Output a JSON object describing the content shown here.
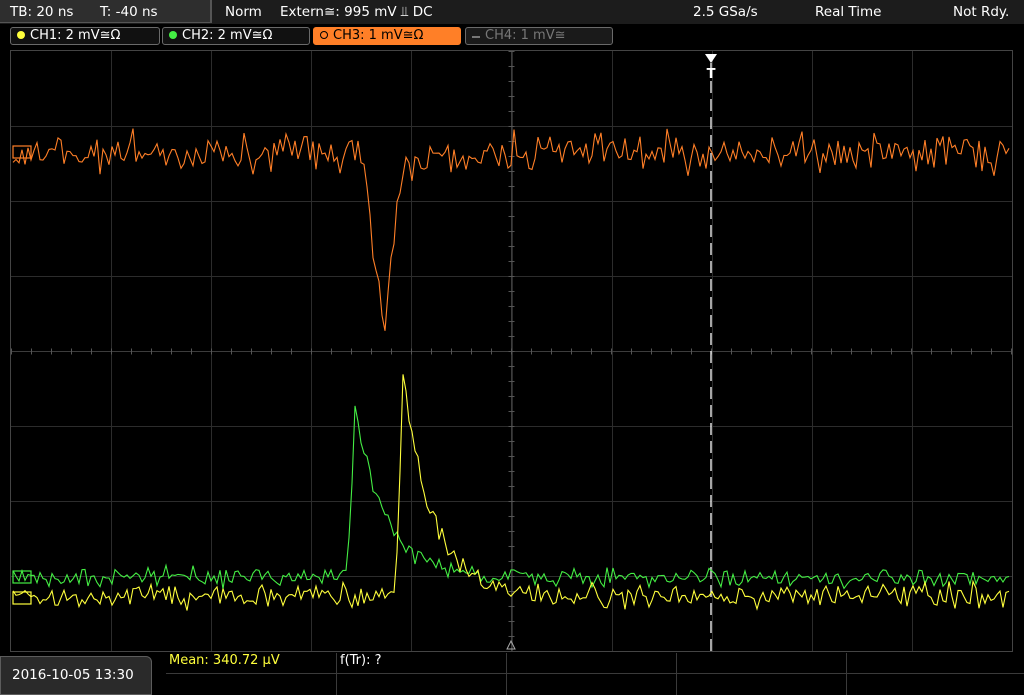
{
  "topbar": {
    "timebase": "TB: 20 ns",
    "trigger_pos": "T: -40 ns",
    "trigger_mode": "Norm",
    "trigger_source": "Extern≅: 995 mV ⫫ DC",
    "sample_rate": "2.5 GSa/s",
    "acq_mode": "Real Time",
    "status": "Not Rdy."
  },
  "channels": [
    {
      "label": "CH1: 2 mV≅Ω",
      "color": "#ffff3c",
      "active": true
    },
    {
      "label": "CH2: 2 mV≅Ω",
      "color": "#44ee44",
      "active": true
    },
    {
      "label": "CH3: 1 mV≅Ω",
      "color": "#ff7f27",
      "active": true,
      "selected": true
    },
    {
      "label": "CH4: 1 mV≅",
      "color": "#666666",
      "active": false
    }
  ],
  "waveform_colors": {
    "ch1": "#ffff3c",
    "ch2": "#44ee44",
    "ch3": "#ff7f27"
  },
  "trigger_marker": "T",
  "footer": {
    "datetime": "2016-10-05 13:30",
    "measurement_1": "Mean: 340.72 µV",
    "measurement_2": "f(Tr): ?"
  }
}
